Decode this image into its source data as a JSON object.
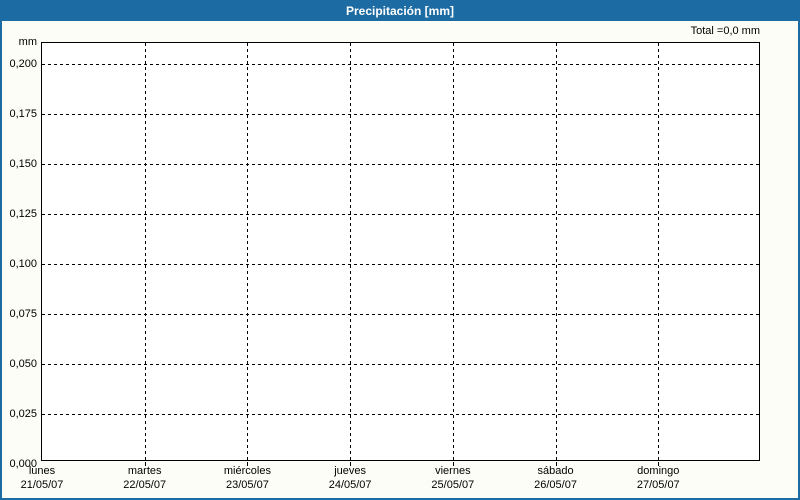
{
  "header": {
    "title": "Precipitación [mm]",
    "total": "Total =0,0 mm"
  },
  "axis": {
    "unit": "mm",
    "y_ticks": [
      "0,200",
      "0,175",
      "0,150",
      "0,125",
      "0,100",
      "0,075",
      "0,050",
      "0,025",
      "0,000"
    ],
    "x_ticks": [
      {
        "day": "lunes",
        "date": "21/05/07"
      },
      {
        "day": "martes",
        "date": "22/05/07"
      },
      {
        "day": "miércoles",
        "date": "23/05/07"
      },
      {
        "day": "jueves",
        "date": "24/05/07"
      },
      {
        "day": "viernes",
        "date": "25/05/07"
      },
      {
        "day": "sábado",
        "date": "26/05/07"
      },
      {
        "day": "domingo",
        "date": "27/05/07"
      }
    ]
  },
  "colors": {
    "accent_blue": "#1d6ba3",
    "grid": "#000000",
    "plot_background": "#ffffff",
    "page_background": "#fdfdf7",
    "title_text": "#ffffff"
  },
  "chart_data": {
    "type": "bar",
    "title": "Precipitación [mm]",
    "xlabel": "",
    "ylabel": "mm",
    "categories": [
      "lunes 21/05/07",
      "martes 22/05/07",
      "miércoles 23/05/07",
      "jueves 24/05/07",
      "viernes 25/05/07",
      "sábado 26/05/07",
      "domingo 27/05/07"
    ],
    "values": [
      0,
      0,
      0,
      0,
      0,
      0,
      0
    ],
    "total": 0.0,
    "total_text": "Total =0,0 mm",
    "ylim": [
      0,
      0.21
    ],
    "ytick_values": [
      0.2,
      0.175,
      0.15,
      0.125,
      0.1,
      0.075,
      0.05,
      0.025,
      0.0
    ],
    "grid": "dashed",
    "legend": "none"
  }
}
